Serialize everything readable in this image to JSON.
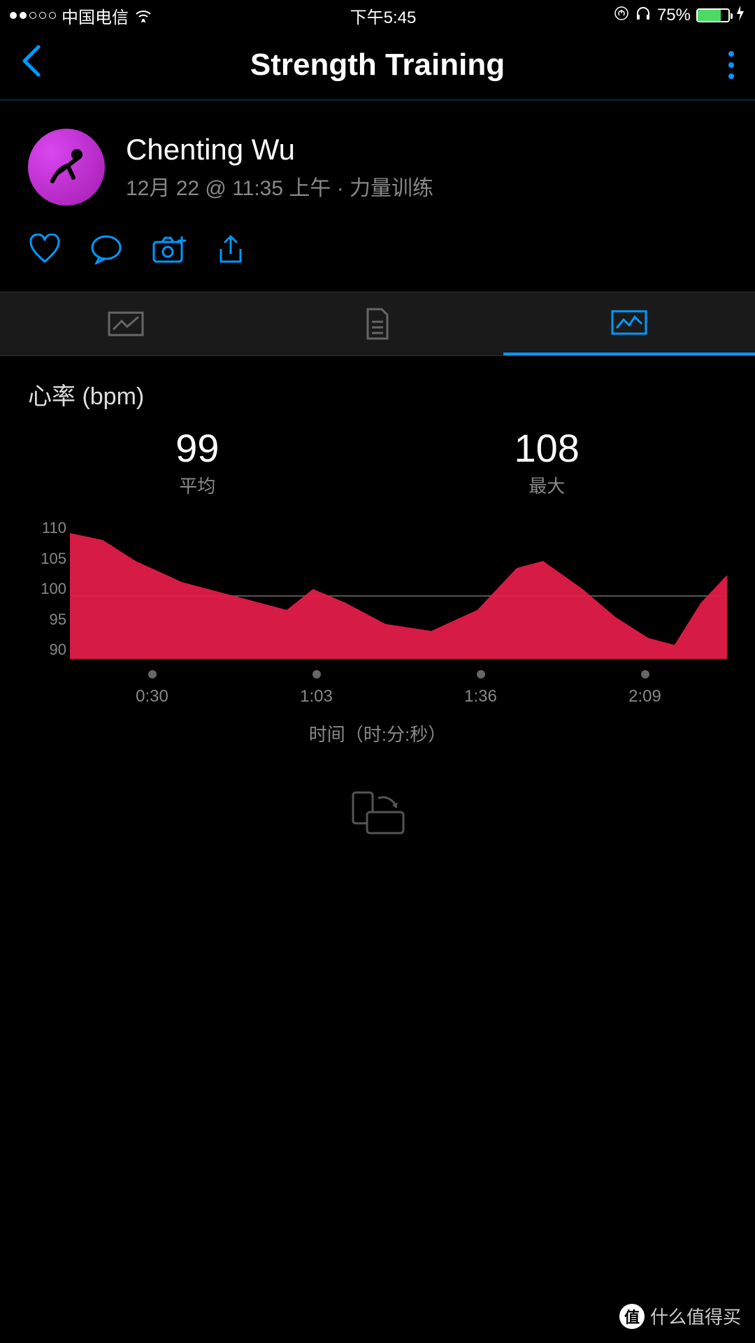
{
  "status": {
    "carrier": "中国电信",
    "time": "下午5:45",
    "battery_pct": "75%"
  },
  "nav": {
    "title": "Strength Training"
  },
  "profile": {
    "name": "Chenting Wu",
    "meta": "12月 22 @ 11:35 上午 · 力量训练"
  },
  "stats": {
    "avg_value": "99",
    "avg_label": "平均",
    "max_value": "108",
    "max_label": "最大"
  },
  "chart_data": {
    "type": "area",
    "title": "心率 (bpm)",
    "xlabel": "时间（时:分:秒）",
    "ylabel": "",
    "ylim": [
      90,
      110
    ],
    "reference": 99,
    "y_ticks": [
      "110",
      "105",
      "100",
      "95",
      "90"
    ],
    "x_ticks": [
      "0:30",
      "1:03",
      "1:36",
      "2:09"
    ],
    "x": [
      0,
      5,
      10,
      17,
      25,
      33,
      37,
      42,
      48,
      55,
      62,
      68,
      72,
      78,
      83,
      88,
      92,
      96,
      100
    ],
    "values": [
      108,
      107,
      104,
      101,
      99,
      97,
      100,
      98,
      95,
      94,
      97,
      103,
      104,
      100,
      96,
      93,
      92,
      98,
      102
    ]
  },
  "watermark": {
    "badge": "值",
    "text": "什么值得买"
  }
}
